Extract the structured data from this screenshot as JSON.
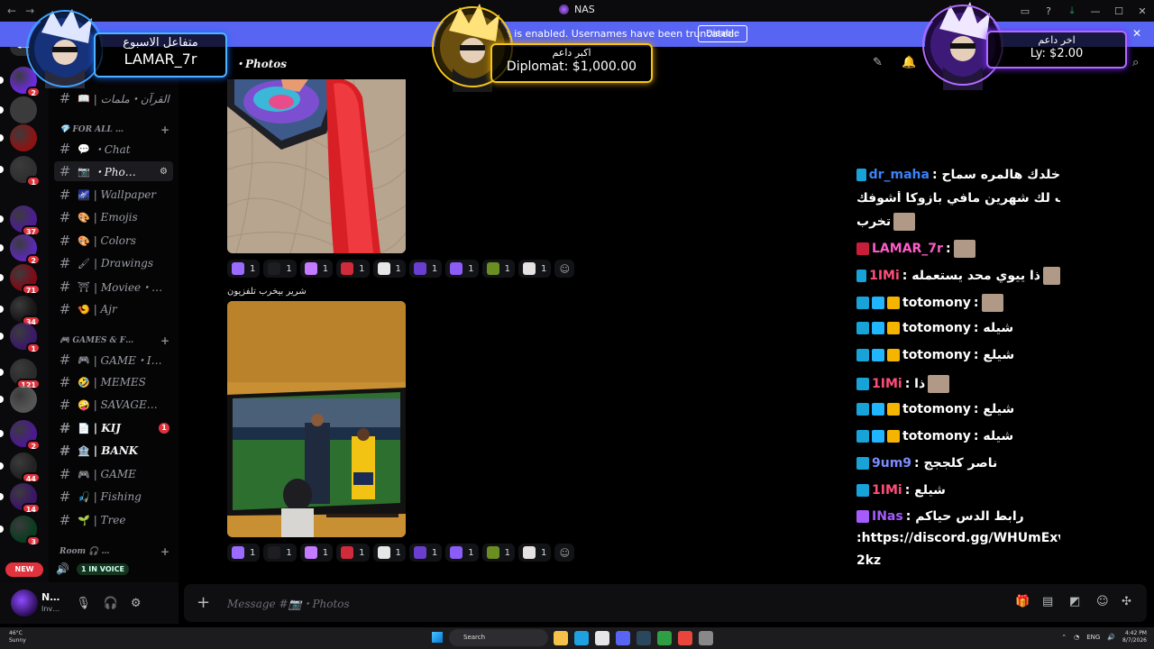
{
  "window": {
    "title": "NAS",
    "nav_back": "←",
    "nav_forward": "→",
    "tool_icons": [
      "▭",
      "?",
      "⤓",
      "—",
      "☐",
      "✕"
    ]
  },
  "notice": {
    "text": "e is enabled. Usernames have been truncated.",
    "button": "Disable",
    "close": "✕"
  },
  "rail": {
    "servers": [
      {
        "badge": "2",
        "color": "#6b2bd9"
      },
      {
        "badge": "",
        "color": "#3b3b3b"
      },
      {
        "badge": "",
        "color": "#8a1414"
      },
      {
        "badge": "1",
        "color": "#2f2f2f"
      },
      {
        "badge": "37",
        "color": "#4a1e8f"
      },
      {
        "badge": "2",
        "color": "#5a2ab0"
      },
      {
        "badge": "71",
        "color": "#7d0b17"
      },
      {
        "badge": "34",
        "color": "#171717"
      },
      {
        "badge": "1",
        "color": "#3a1a66"
      },
      {
        "badge": "121",
        "color": "#2a2a2a"
      },
      {
        "badge": "",
        "color": "#555555"
      },
      {
        "badge": "2",
        "color": "#4b1a8f"
      },
      {
        "badge": "44",
        "color": "#222222"
      },
      {
        "badge": "14",
        "color": "#3b1566"
      },
      {
        "badge": "3",
        "color": "#0d3b20"
      }
    ],
    "new_label": "NEW"
  },
  "sidebar": {
    "channels": [
      {
        "emoji": "📖",
        "name": "| القرآن・ملمات",
        "style": "normal"
      },
      {
        "emoji": "💬",
        "name": "・Chat",
        "style": "normal"
      },
      {
        "emoji": "📷",
        "name": "・Pho…",
        "style": "active"
      },
      {
        "emoji": "🌌",
        "name": "| Wallpaper",
        "style": "normal"
      },
      {
        "emoji": "🎨",
        "name": "| Emojis",
        "style": "normal"
      },
      {
        "emoji": "🎨",
        "name": "| Colors",
        "style": "normal"
      },
      {
        "emoji": "🖌",
        "name": "| Drawings",
        "style": "normal"
      },
      {
        "emoji": "⛩",
        "name": "| Moviee・…",
        "style": "normal"
      },
      {
        "emoji": "🍤",
        "name": "| Ajr",
        "style": "normal"
      },
      {
        "emoji": "🎮",
        "name": "| GAME・I…",
        "style": "normal"
      },
      {
        "emoji": "🤣",
        "name": "| MEMES",
        "style": "normal"
      },
      {
        "emoji": "🤪",
        "name": "| SAVAGE…",
        "style": "normal"
      },
      {
        "emoji": "📄",
        "name": "| KIJ",
        "style": "bold"
      },
      {
        "emoji": "🏦",
        "name": "| BANK",
        "style": "bold"
      },
      {
        "emoji": "🎮",
        "name": "| GAME",
        "style": "normal"
      },
      {
        "emoji": "🎣",
        "name": "| Fishing",
        "style": "normal"
      },
      {
        "emoji": "🌱",
        "name": "| Tree",
        "style": "normal"
      }
    ],
    "categories": [
      "💎 FOR ALL …",
      "🎮 GAMES & F…",
      "Room 🎧 …"
    ],
    "kij_count": "1",
    "in_voice": "1 IN VOICE",
    "hash": "#",
    "plus": "+"
  },
  "user": {
    "name": "N…",
    "status": "Inv…",
    "mic": "🎙",
    "headset": "🎧",
    "settings": "⚙"
  },
  "channel_header": {
    "name": "・Photos"
  },
  "boosters": {
    "weekly": {
      "title": "متفاعل الاسبوع",
      "name": "LAMAR_7r"
    },
    "top": {
      "title": "اكبر داعم",
      "value": "Diplomat: $1,000.00"
    },
    "last": {
      "title": "اخر داعم",
      "value": "Ly: $2.00"
    }
  },
  "messages": {
    "reactions": [
      "1",
      "1",
      "1",
      "1",
      "1",
      "1",
      "1",
      "1",
      "1"
    ],
    "caption": "شرير بيخرب تلفزيون"
  },
  "overlay": {
    "lines": [
      {
        "user": "dr_maha",
        "color": "#3b82f6",
        "msg": ": خلدك هالمره سماح"
      },
      {
        "user": "",
        "color": "#ffffff",
        "msg": "وعقاب لك شهرين مافي بازوكا أشوفك"
      },
      {
        "user": "",
        "color": "#ffffff",
        "msg": "تخرب"
      },
      {
        "user": "LAMAR_7r",
        "color": "#ff5cc8",
        "msg": ":"
      },
      {
        "user": "1IMi",
        "color": "#ff4d7a",
        "msg": ": ذا ييوي محد يستعمله"
      },
      {
        "user": "totomony",
        "color": "#ffffff",
        "msg": ":"
      },
      {
        "user": "totomony",
        "color": "#ffffff",
        "msg": ": شيله"
      },
      {
        "user": "totomony",
        "color": "#ffffff",
        "msg": ": شيلع"
      },
      {
        "user": "1IMi",
        "color": "#ff4d7a",
        "msg": ": ذا"
      },
      {
        "user": "totomony",
        "color": "#ffffff",
        "msg": ": شيلع"
      },
      {
        "user": "totomony",
        "color": "#ffffff",
        "msg": ": شيله"
      },
      {
        "user": "9um9",
        "color": "#7c8cff",
        "msg": ": ناصر كلججج"
      },
      {
        "user": "1IMi",
        "color": "#ff4d7a",
        "msg": ": شيلع"
      },
      {
        "user": "INas",
        "color": "#a55cff",
        "msg": ": رابط الدس حياكم"
      },
      {
        "user": "",
        "color": "#ffffff",
        "msg": ":https://discord.gg/WHUmExv"
      },
      {
        "user": "",
        "color": "#ffffff",
        "msg": "2kz"
      }
    ]
  },
  "composer": {
    "placeholder": "Message #📷・Photos",
    "plus": "+"
  },
  "taskbar": {
    "weather_temp": "46°C",
    "weather_text": "Sunny",
    "search": "Search",
    "lang": "ENG",
    "time": "4:42 PM",
    "date": "8/7/2026"
  }
}
